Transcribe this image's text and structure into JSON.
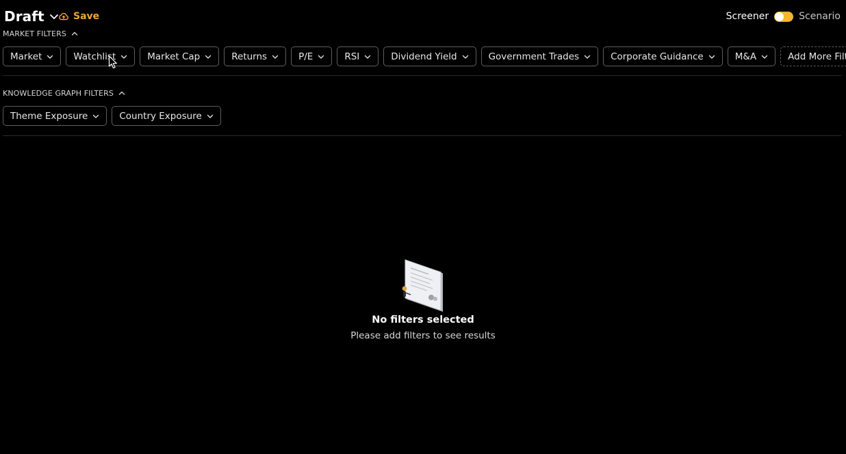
{
  "header": {
    "title": "Draft",
    "save_label": "Save",
    "mode_left": "Screener",
    "mode_right": "Scenario"
  },
  "market_filters": {
    "label": "MARKET FILTERS",
    "chips": [
      "Market",
      "Watchlist",
      "Market Cap",
      "Returns",
      "P/E",
      "RSI",
      "Dividend Yield",
      "Government Trades",
      "Corporate Guidance",
      "M&A"
    ],
    "add_more_label": "Add More Filters"
  },
  "knowledge_filters": {
    "label": "KNOWLEDGE GRAPH FILTERS",
    "chips": [
      "Theme Exposure",
      "Country Exposure"
    ]
  },
  "empty_state": {
    "title": "No filters selected",
    "subtitle": "Please add filters to see results"
  },
  "colors": {
    "accent": "#f0a63a",
    "toggle": "#f5b52e",
    "background": "#000000"
  },
  "icons": {
    "title_chevron": "chevron-down-icon",
    "save": "cloud-save-icon",
    "section_caret": "chevron-up-icon",
    "chip_chevron": "chevron-down-icon",
    "add": "plus-icon",
    "empty": "empty-document-illustration"
  }
}
